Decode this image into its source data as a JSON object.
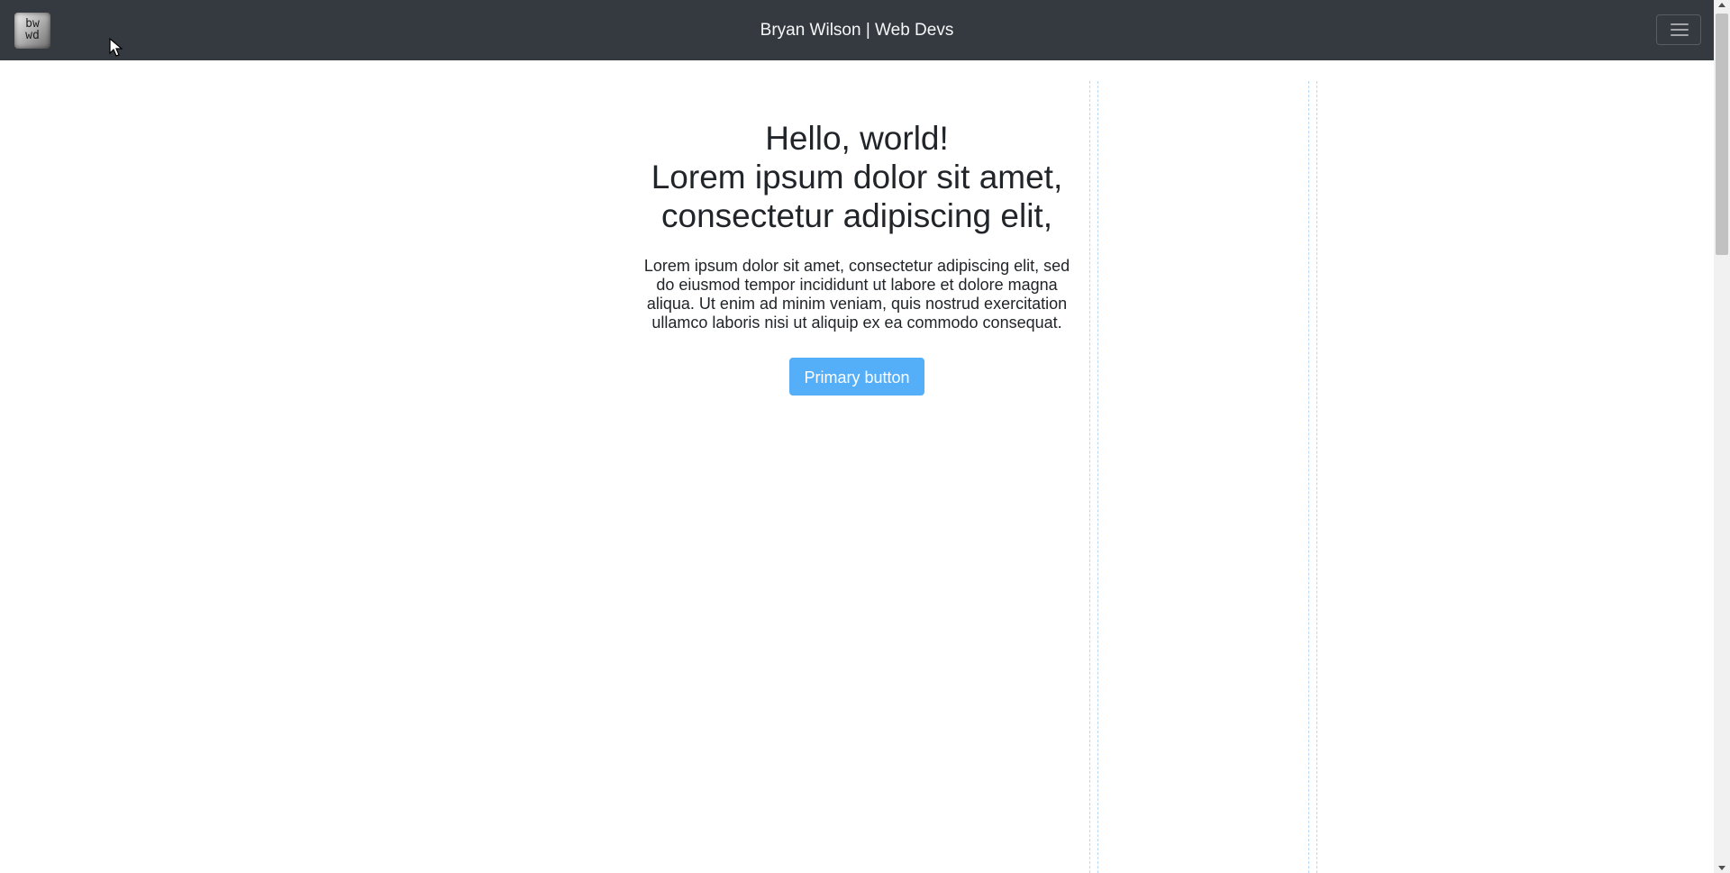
{
  "header": {
    "logo_lines": [
      "bw",
      "wd"
    ],
    "site_title": "Bryan Wilson | Web Devs"
  },
  "hero": {
    "heading_lines": [
      "Hello, world!",
      "Lorem ipsum dolor sit amet,",
      "consectetur adipiscing elit,"
    ],
    "body": "Lorem ipsum dolor sit amet, consectetur adipiscing elit, sed do eiusmod tempor incididunt ut labore et dolore magna aliqua. Ut enim ad minim veniam, quis nostrud exercitation ullamco laboris nisi ut aliquip ex ea commodo consequat.",
    "button_label": "Primary button"
  },
  "icons": {
    "menu": "hamburger-menu-icon",
    "cursor": "mouse-pointer-icon"
  },
  "colors": {
    "navbar_background": "#343a40",
    "button_background": "#55aef8",
    "guide_line": "#b9d8f3"
  }
}
